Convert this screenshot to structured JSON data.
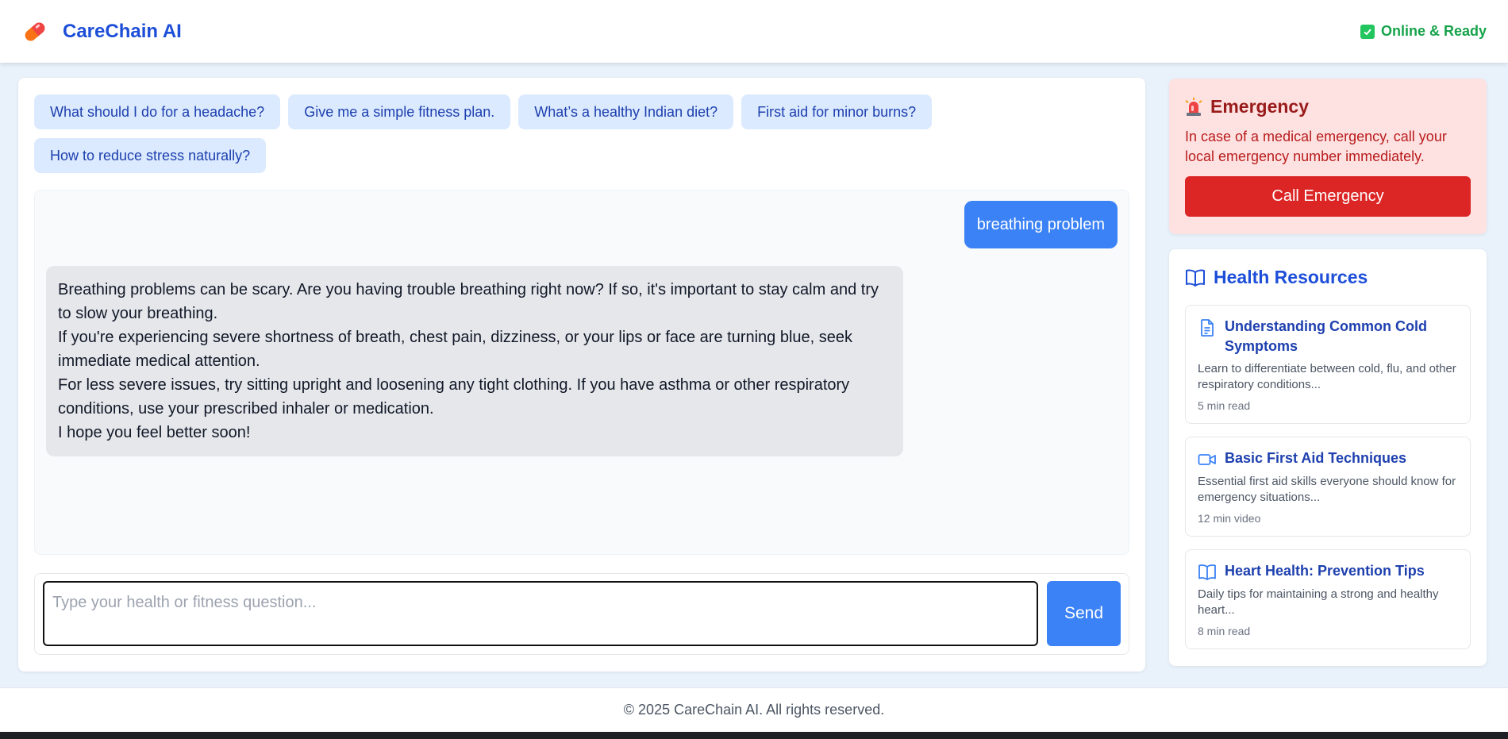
{
  "header": {
    "brand_name": "CareChain AI",
    "status": "Online & Ready"
  },
  "chips": [
    "What should I do for a headache?",
    "Give me a simple fitness plan.",
    "What’s a healthy Indian diet?",
    "First aid for minor burns?",
    "How to reduce stress naturally?"
  ],
  "messages": {
    "user": "breathing problem",
    "bot": [
      "Breathing problems can be scary. Are you having trouble breathing right now? If so, it's important to stay calm and try to slow your breathing.",
      "If you're experiencing severe shortness of breath, chest pain, dizziness, or your lips or face are turning blue, seek immediate medical attention.",
      "For less severe issues, try sitting upright and loosening any tight clothing. If you have asthma or other respiratory conditions, use your prescribed inhaler or medication.",
      "I hope you feel better soon!"
    ]
  },
  "input": {
    "value": "",
    "placeholder": "Type your health or fitness question...",
    "send_label": "Send"
  },
  "emergency": {
    "title": "Emergency",
    "text": "In case of a medical emergency, call your local emergency number immediately.",
    "button_label": "Call Emergency"
  },
  "resources": {
    "title": "Health Resources",
    "items": [
      {
        "icon": "document-icon",
        "title": "Understanding Common Cold Symptoms",
        "description": "Learn to differentiate between cold, flu, and other respiratory conditions...",
        "meta": "5 min read"
      },
      {
        "icon": "video-icon",
        "title": "Basic First Aid Techniques",
        "description": "Essential first aid skills everyone should know for emergency situations...",
        "meta": "12 min video"
      },
      {
        "icon": "book-icon",
        "title": "Heart Health: Prevention Tips",
        "description": "Daily tips for maintaining a strong and healthy heart...",
        "meta": "8 min read"
      }
    ]
  },
  "footer": {
    "text": "© 2025 CareChain AI. All rights reserved."
  },
  "colors": {
    "primary": "#3b82f6",
    "brand": "#1d4ed8",
    "emergency": "#dc2626",
    "online": "#16a34a"
  }
}
